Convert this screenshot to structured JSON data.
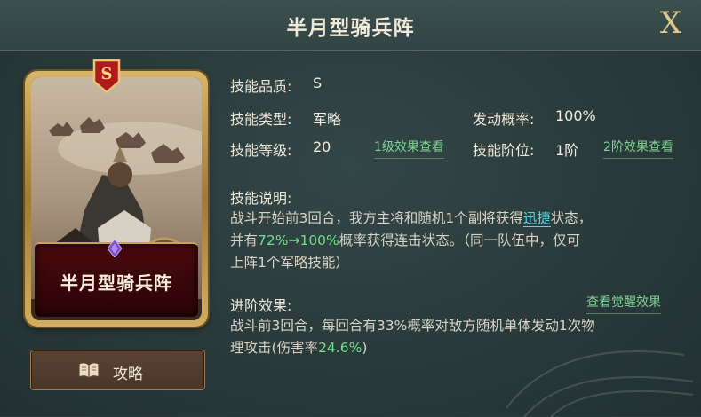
{
  "dialog": {
    "title": "半月型骑兵阵",
    "close_label": "X"
  },
  "card": {
    "grade_badge": "S",
    "name": "半月型骑兵阵"
  },
  "guide_button": {
    "label": "攻略",
    "icon": "book-icon"
  },
  "info": {
    "quality_label": "技能品质:",
    "quality_value": "S",
    "type_label": "技能类型:",
    "type_value": "军略",
    "level_label": "技能等级:",
    "level_value": "20",
    "level_link": "1级效果查看",
    "chance_label": "发动概率:",
    "chance_value": "100%",
    "rank_label": "技能阶位:",
    "rank_value": "1阶",
    "rank_link": "2阶效果查看"
  },
  "description": {
    "heading": "技能说明:",
    "line1_a": "战斗开始前3回合，我方主将和随机1个副将获得",
    "line1_hl": "迅捷",
    "line1_b": "状态，",
    "line2_a": "并有",
    "line2_hl": "72%→100%",
    "line2_b": "概率获得连击状态。（同一队伍中，仅可",
    "line3": "上阵1个军略技能）"
  },
  "advanced": {
    "heading": "进阶效果:",
    "link": "查看觉醒效果",
    "line1": "战斗前3回合，每回合有33%概率对敌方随机单体发动1次物",
    "line2_a": "理攻击(伤害率",
    "line2_hl": "24.6%",
    "line2_b": ")"
  },
  "colors": {
    "accent_green": "#7fd596",
    "highlight_cyan": "#58d8e6",
    "gold": "#e0c98c"
  }
}
